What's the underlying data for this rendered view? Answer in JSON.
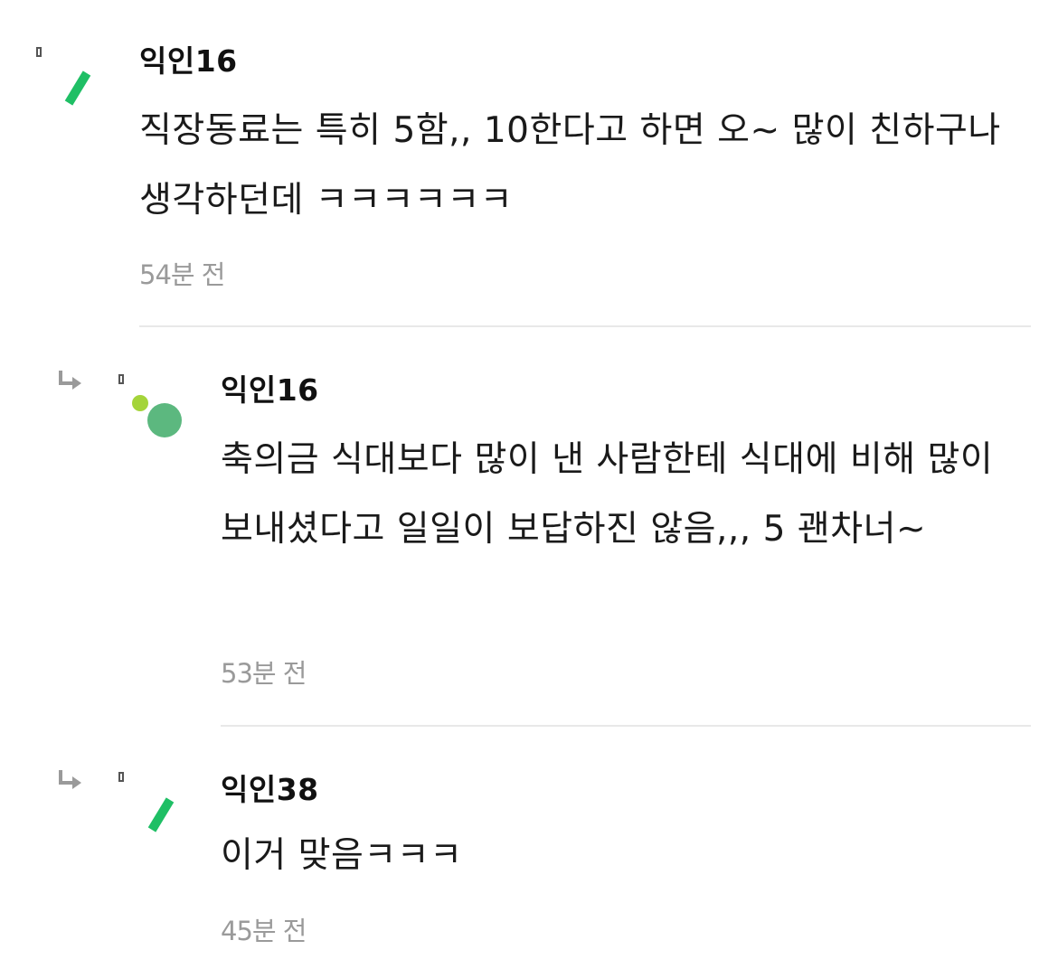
{
  "colors": {
    "accent_green": "#1fbf65",
    "light_green": "#a4d43a",
    "mid_green": "#5cb87f",
    "meta_gray": "#9a9a9a",
    "divider": "#e8e8e8"
  },
  "comments": [
    {
      "author": "익인16",
      "text": "직장동료는 특히 5함,, 10한다고 하면 오~ 많이 친하구나 생각하던데 ㅋㅋㅋㅋㅋㅋ",
      "time": "54분 전",
      "avatar_icon": "green-slash-avatar-icon",
      "is_reply": false
    },
    {
      "author": "익인16",
      "text": "축의금 식대보다 많이 낸 사람한테 식대에 비해 많이 보내셨다고 일일이 보답하진 않음,,, 5 괜차너~",
      "time": "53분 전",
      "avatar_icon": "green-dots-avatar-icon",
      "is_reply": true
    },
    {
      "author": "익인38",
      "text": "이거 맞음ㅋㅋㅋ",
      "time": "45분 전",
      "avatar_icon": "green-slash-avatar-icon",
      "is_reply": true
    }
  ]
}
